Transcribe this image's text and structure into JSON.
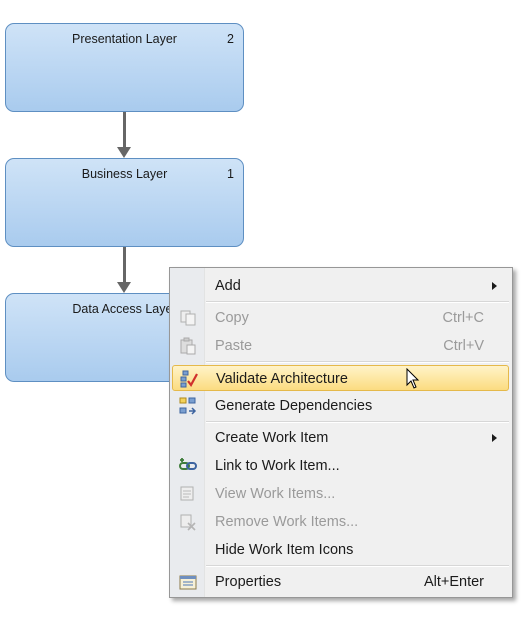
{
  "diagram": {
    "layers": [
      {
        "name": "Presentation Layer",
        "count": "2"
      },
      {
        "name": "Business Layer",
        "count": "1"
      },
      {
        "name": "Data Access Layer",
        "count": ""
      }
    ]
  },
  "context_menu": {
    "items": [
      {
        "label": "Add",
        "shortcut": "",
        "enabled": true,
        "submenu": true
      },
      {
        "label": "Copy",
        "shortcut": "Ctrl+C",
        "enabled": false,
        "icon": "copy-icon"
      },
      {
        "label": "Paste",
        "shortcut": "Ctrl+V",
        "enabled": false,
        "icon": "paste-icon"
      },
      {
        "label": "Validate Architecture",
        "shortcut": "",
        "enabled": true,
        "highlighted": true,
        "icon": "validate-icon"
      },
      {
        "label": "Generate Dependencies",
        "shortcut": "",
        "enabled": true,
        "icon": "generate-dependencies-icon"
      },
      {
        "label": "Create Work Item",
        "shortcut": "",
        "enabled": true,
        "submenu": true
      },
      {
        "label": "Link to Work Item...",
        "shortcut": "",
        "enabled": true,
        "icon": "link-icon"
      },
      {
        "label": "View Work Items...",
        "shortcut": "",
        "enabled": false,
        "icon": "view-work-items-icon"
      },
      {
        "label": "Remove Work Items...",
        "shortcut": "",
        "enabled": false,
        "icon": "remove-work-items-icon"
      },
      {
        "label": "Hide Work Item Icons",
        "shortcut": "",
        "enabled": true
      },
      {
        "label": "Properties",
        "shortcut": "Alt+Enter",
        "enabled": true,
        "icon": "properties-icon"
      }
    ]
  },
  "colors": {
    "layer_fill": "#b7d4f1",
    "layer_border": "#5e8fc2",
    "highlight": "#fbdc80"
  }
}
